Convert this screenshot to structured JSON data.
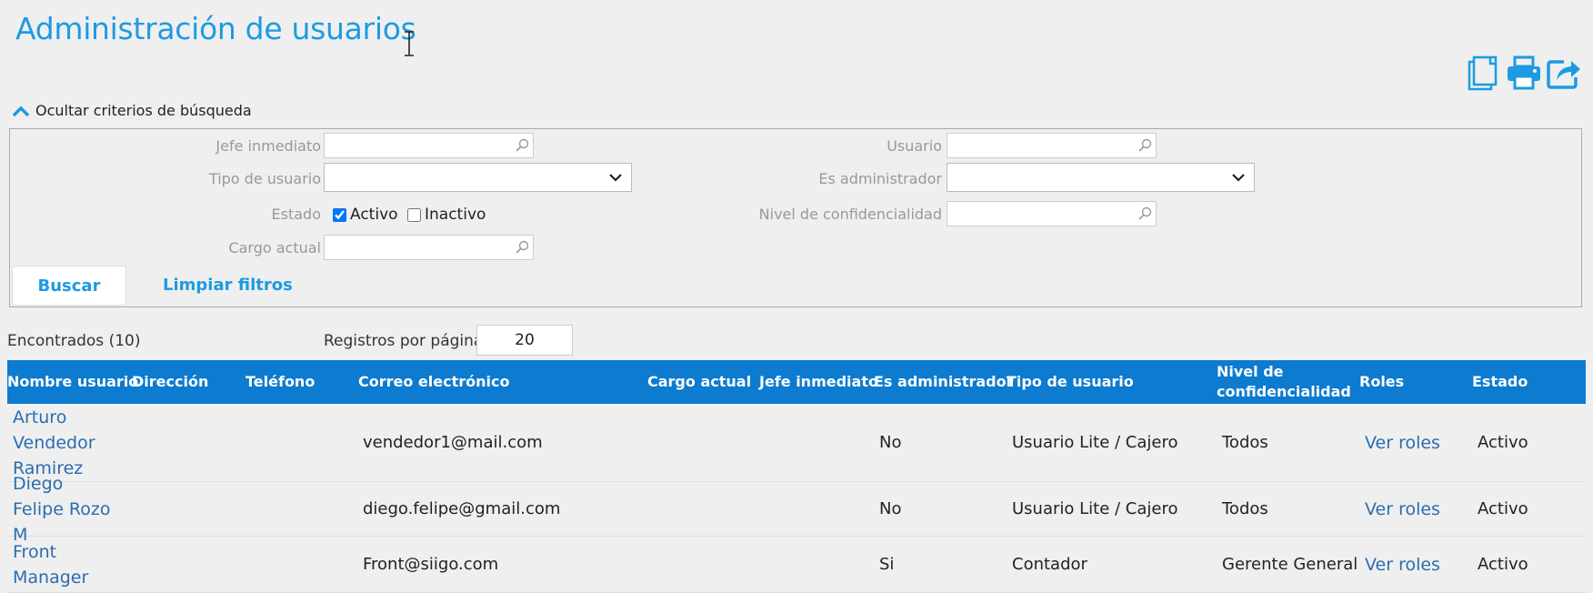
{
  "page": {
    "title": "Administración de usuarios",
    "toggle_label": "Ocultar criterios de búsqueda"
  },
  "toolbar": {
    "icons": [
      "copy-icon",
      "print-icon",
      "share-icon"
    ]
  },
  "filters": {
    "jefe_label": "Jefe inmediato",
    "usuario_label": "Usuario",
    "tipo_label": "Tipo de usuario",
    "admin_label": "Es administrador",
    "estado_label": "Estado",
    "activo_label": "Activo",
    "inactivo_label": "Inactivo",
    "activo_checked": true,
    "inactivo_checked": false,
    "nivel_label": "Nivel de confidencialidad",
    "cargo_label": "Cargo actual",
    "buscar_label": "Buscar",
    "limpiar_label": "Limpiar filtros"
  },
  "results": {
    "found_label": "Encontrados (10)",
    "perpage_label": "Registros por página",
    "perpage_value": "20"
  },
  "table": {
    "headers": {
      "nombre": "Nombre usuario",
      "direccion": "Dirección",
      "telefono": "Teléfono",
      "correo": "Correo electrónico",
      "cargo": "Cargo actual",
      "jefe": "Jefe inmediato",
      "admin": "Es administrador",
      "tipo": "Tipo de usuario",
      "nivel": "Nivel de confidencialidad",
      "roles": "Roles",
      "estado": "Estado"
    },
    "rows": [
      {
        "nombre": "Arturo Vendedor Ramirez",
        "correo": "vendedor1@mail.com",
        "admin": "No",
        "tipo": "Usuario Lite / Cajero",
        "nivel": "Todos",
        "roles": "Ver roles",
        "estado": "Activo"
      },
      {
        "nombre": "Diego Felipe Rozo M",
        "correo": "diego.felipe@gmail.com",
        "admin": "No",
        "tipo": "Usuario Lite / Cajero",
        "nivel": "Todos",
        "roles": "Ver roles",
        "estado": "Activo"
      },
      {
        "nombre": "Front Manager",
        "correo": "Front@siigo.com",
        "admin": "Si",
        "tipo": "Contador",
        "nivel": "Gerente General",
        "roles": "Ver roles",
        "estado": "Activo"
      }
    ]
  }
}
